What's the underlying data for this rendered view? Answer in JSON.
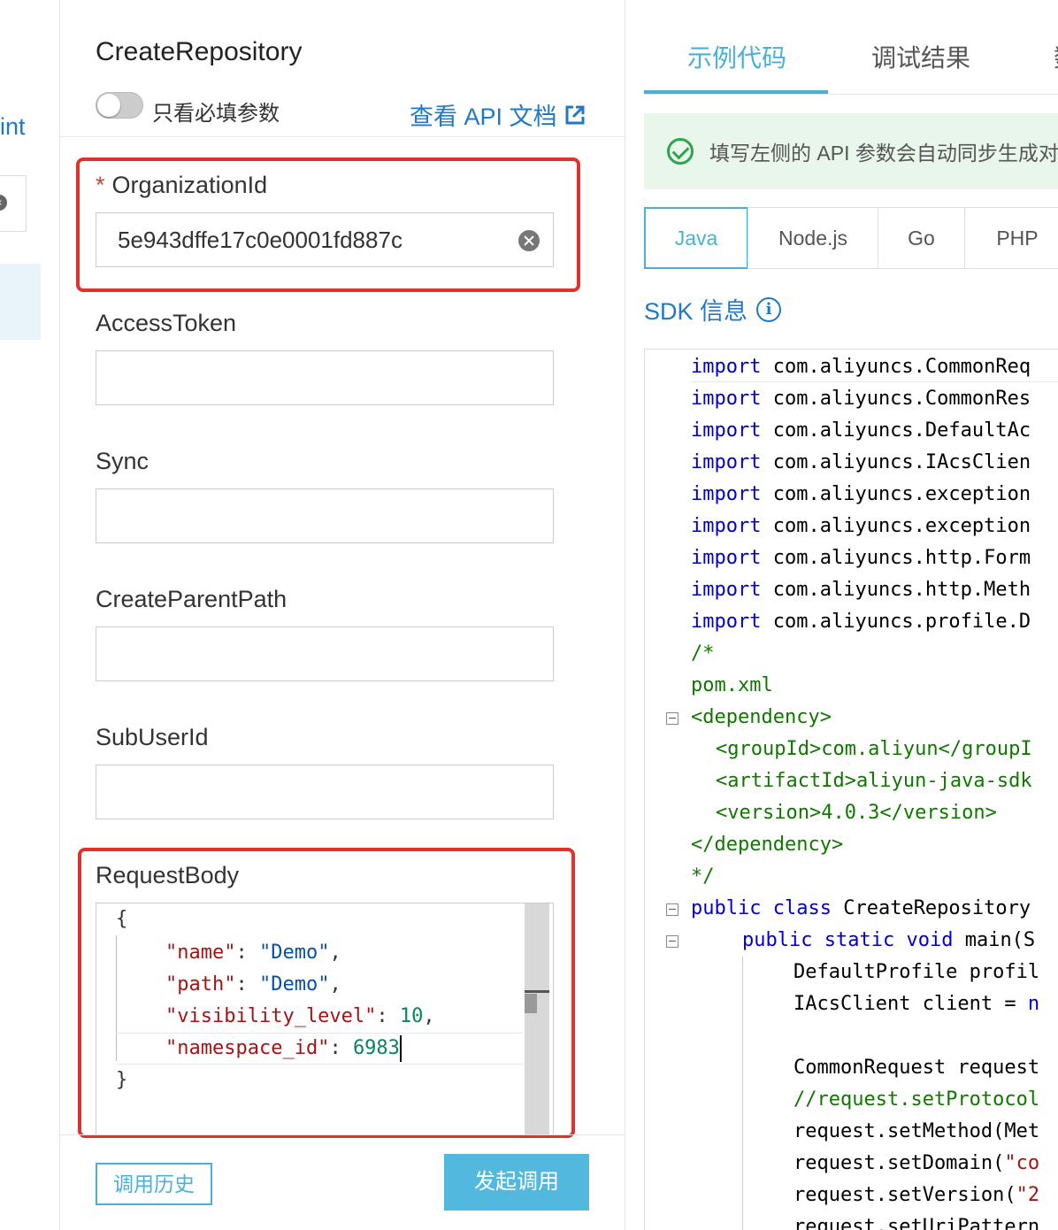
{
  "left_strip": {
    "fragment_text": "int",
    "clear_glyph": "×"
  },
  "panel": {
    "title": "CreateRepository",
    "toggle_label": "只看必填参数",
    "doc_link": "查看 API 文档",
    "fields": [
      {
        "label": "OrganizationId",
        "required": "*",
        "value": "5e943dffe17c0e0001fd887c"
      },
      {
        "label": "AccessToken",
        "value": ""
      },
      {
        "label": "Sync",
        "value": ""
      },
      {
        "label": "CreateParentPath",
        "value": ""
      },
      {
        "label": "SubUserId",
        "value": ""
      },
      {
        "label": "RequestBody"
      }
    ],
    "request_body": {
      "open": "{",
      "close": "}",
      "entries": [
        {
          "key": "\"name\"",
          "sep": ": ",
          "value": "\"Demo\"",
          "end": ","
        },
        {
          "key": "\"path\"",
          "sep": ": ",
          "value": "\"Demo\"",
          "end": ","
        },
        {
          "key": "\"visibility_level\"",
          "sep": ": ",
          "value": "10",
          "end": ","
        },
        {
          "key": "\"namespace_id\"",
          "sep": ": ",
          "value": "6983",
          "end": ""
        }
      ]
    },
    "history_button": "调用历史",
    "invoke_button": "发起调用"
  },
  "right": {
    "tabs": [
      "示例代码",
      "调试结果",
      "数"
    ],
    "notice": "填写左侧的 API 参数会自动同步生成对",
    "languages": [
      "Java",
      "Node.js",
      "Go",
      "PHP"
    ],
    "sdk_info": "SDK 信息",
    "info_glyph": "i",
    "code": {
      "imports": [
        "com.aliyuncs.CommonReq",
        "com.aliyuncs.CommonRes",
        "com.aliyuncs.DefaultAc",
        "com.aliyuncs.IAcsClien",
        "com.aliyuncs.exception",
        "com.aliyuncs.exception",
        "com.aliyuncs.http.Form",
        "com.aliyuncs.http.Meth",
        "com.aliyuncs.profile.D"
      ],
      "import_kw": "import",
      "comment_open": "/*",
      "pom": "pom.xml",
      "dep_open": "<dependency>",
      "group": "<groupId>com.aliyun</groupI",
      "artifact": "<artifactId>aliyun-java-sdk",
      "version": "<version>4.0.3</version>",
      "dep_close": "</dependency>",
      "comment_close": "*/",
      "class_kw1": "public",
      "class_kw2": "class",
      "class_name": "CreateRepository",
      "main_kw1": "public",
      "main_kw2": "static",
      "main_kw3": "void",
      "main_rest": "main(S",
      "profile_line": "DefaultProfile profil",
      "client_line_a": "IAcsClient client = ",
      "client_line_b": "n",
      "request_line": "CommonRequest request",
      "protocol_comment": "//request.setProtocol",
      "method_line": "request.setMethod(Met",
      "domain_line_a": "request.setDomain(",
      "domain_line_b": "\"co",
      "version_line_a": "request.setVersion(",
      "version_line_b": "\"2",
      "uri_line": "request.setUriPattern"
    }
  }
}
